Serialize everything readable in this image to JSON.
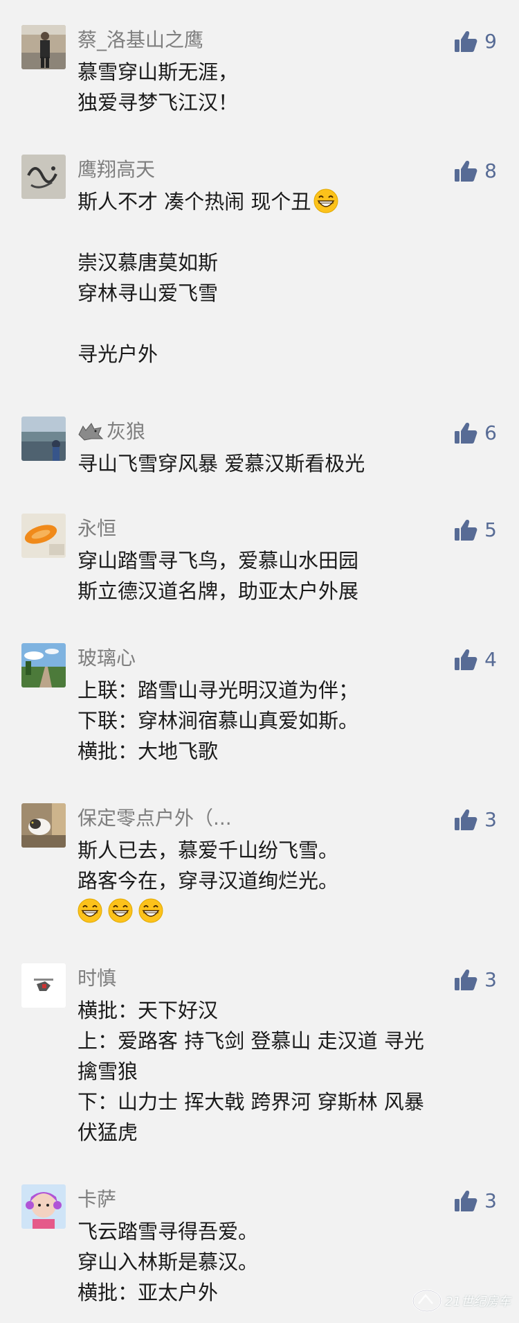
{
  "colors": {
    "background": "#f2f2f2",
    "name": "#7e7e7e",
    "like": "#576b95",
    "text": "#1a1a1a"
  },
  "comments": [
    {
      "name": "蔡_洛基山之鹰",
      "likes": "9",
      "lines": [
        "慕雪穿山斯无涯，",
        "独爱寻梦飞江汉！"
      ]
    },
    {
      "name": "鹰翔高天",
      "likes": "8",
      "lines": [
        "斯人不才 凑个热闹 现个丑",
        "",
        "崇汉慕唐莫如斯",
        "穿林寻山爱飞雪",
        "",
        "寻光户外"
      ]
    },
    {
      "name": "灰狼",
      "likes": "6",
      "lines": [
        "寻山飞雪穿风暴 爱慕汉斯看极光"
      ]
    },
    {
      "name": "永恒",
      "likes": "5",
      "lines": [
        "穿山踏雪寻飞鸟，爱慕山水田园",
        "斯立德汉道名牌，助亚太户外展"
      ]
    },
    {
      "name": "玻璃心",
      "likes": "4",
      "lines": [
        "上联：踏雪山寻光明汉道为伴；",
        "下联：穿林涧宿慕山真爱如斯。",
        "横批：大地飞歌"
      ]
    },
    {
      "name": "保定零点户外（...",
      "likes": "3",
      "lines": [
        "斯人已去，慕爱千山纷飞雪。",
        "路客今在，穿寻汉道绚烂光。"
      ]
    },
    {
      "name": "时慎",
      "likes": "3",
      "lines": [
        "横批：天下好汉",
        "上：爱路客 持飞剑 登慕山 走汉道 寻光",
        "擒雪狼",
        "下：山力士 挥大戟 跨界河 穿斯林 风暴",
        "伏猛虎"
      ]
    },
    {
      "name": "卡萨",
      "likes": "3",
      "lines": [
        "飞云踏雪寻得吾爱。",
        "穿山入林斯是慕汉。",
        "横批：亚太户外"
      ]
    }
  ],
  "watermark": "21世纪房车"
}
